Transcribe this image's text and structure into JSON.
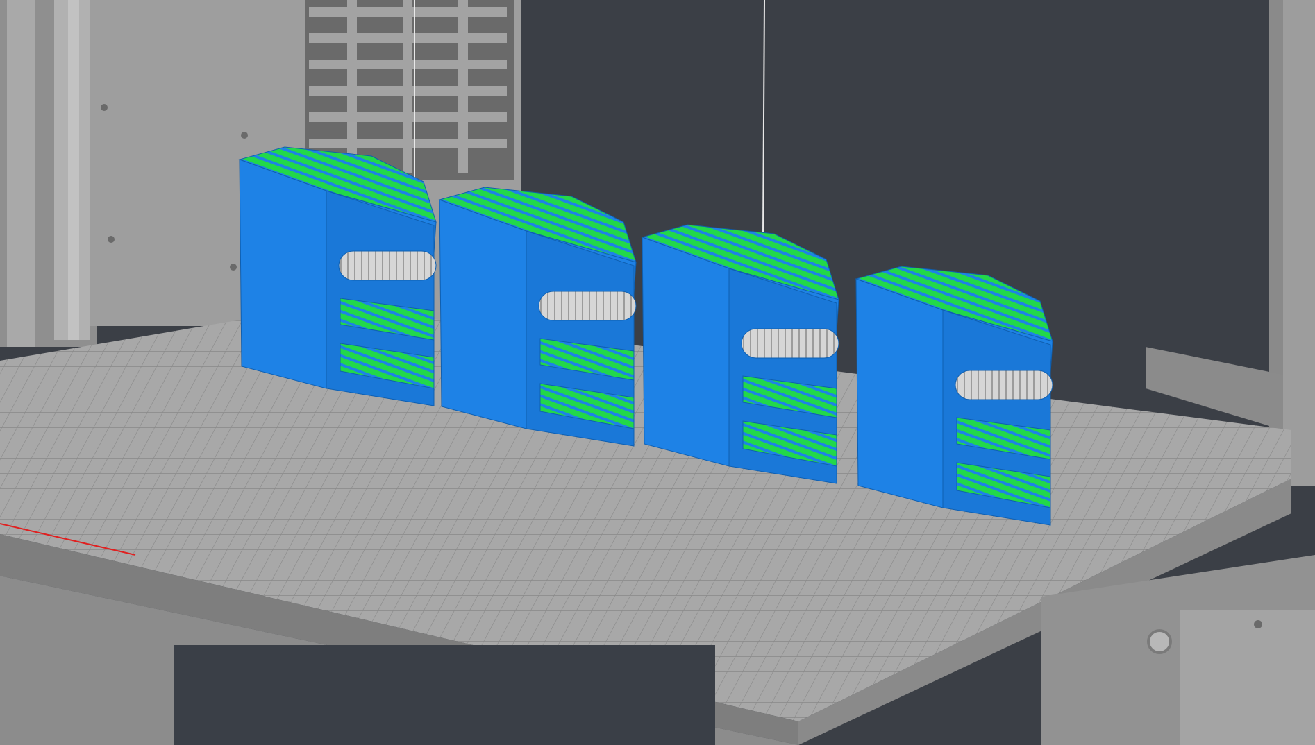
{
  "app": {
    "view": "3d-slice-preview"
  },
  "scene": {
    "printer": "3d-printer-enclosure",
    "bed": "print-bed",
    "object_count": 4,
    "objects": [
      {
        "id": "part-1"
      },
      {
        "id": "part-2"
      },
      {
        "id": "part-3"
      },
      {
        "id": "part-4"
      }
    ]
  },
  "colors": {
    "background": "#3b3f46",
    "frame_gray": "#9a9a9a",
    "bed_gray": "#a6a6a6",
    "perimeter_blue": "#1e82e6",
    "infill_green": "#22d84a",
    "bridge_white": "#d6d6d6",
    "axis_red": "#e02020"
  }
}
